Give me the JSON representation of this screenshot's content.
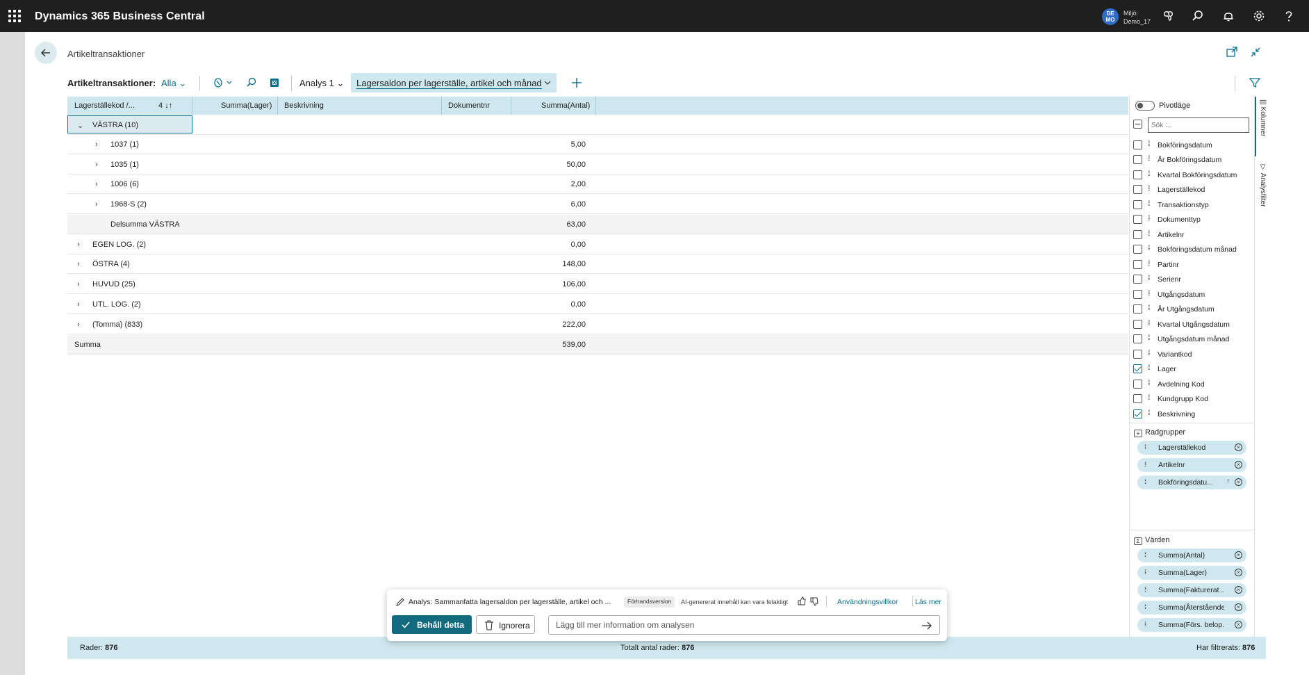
{
  "app": {
    "name": "Dynamics 365 Business Central",
    "avatar_initials_top": "DE",
    "avatar_initials_bottom": "MO",
    "env_label": "Miljö:",
    "env_name": "Demo_17"
  },
  "page": {
    "title": "Artikeltransaktioner"
  },
  "actionbar": {
    "title": "Artikeltransaktioner:",
    "filter": "Alla",
    "analysis": "Analys 1",
    "active_tab": "Lagersaldon per lagerställe, artikel och månad"
  },
  "grid": {
    "columns": {
      "group": "Lagerställekod /...",
      "sort": "4",
      "summa_lager": "Summa(Lager)",
      "beskrivning": "Beskrivning",
      "dokumentnr": "Dokumentnr",
      "summa_antal": "Summa(Antal)"
    },
    "rows": [
      {
        "label": "VÄSTRA (10)",
        "value": ""
      },
      {
        "label": "1037 (1)",
        "value": "5,00"
      },
      {
        "label": "1035 (1)",
        "value": "50,00"
      },
      {
        "label": "1006 (6)",
        "value": "2,00"
      },
      {
        "label": "1968-S (2)",
        "value": "6,00"
      },
      {
        "label": "Delsumma VÄSTRA",
        "value": "63,00"
      },
      {
        "label": "EGEN LOG. (2)",
        "value": "0,00"
      },
      {
        "label": "ÖSTRA (4)",
        "value": "148,00"
      },
      {
        "label": "HUVUD (25)",
        "value": "106,00"
      },
      {
        "label": "UTL. LOG. (2)",
        "value": "0,00"
      },
      {
        "label": "(Tomma) (833)",
        "value": "222,00"
      },
      {
        "label": "Summa",
        "value": "539,00"
      }
    ]
  },
  "pivot_panel": {
    "pivot_label": "Pivotläge",
    "search_placeholder": "Sök ...",
    "fields": [
      {
        "name": "Bokföringsdatum",
        "checked": false
      },
      {
        "name": "År Bokföringsdatum",
        "checked": false
      },
      {
        "name": "Kvartal Bokföringsdatum",
        "checked": false
      },
      {
        "name": "Lagerställekod",
        "checked": false
      },
      {
        "name": "Transaktionstyp",
        "checked": false
      },
      {
        "name": "Dokumenttyp",
        "checked": false
      },
      {
        "name": "Artikelnr",
        "checked": false
      },
      {
        "name": "Bokföringsdatum månad",
        "checked": false
      },
      {
        "name": "Partinr",
        "checked": false
      },
      {
        "name": "Serienr",
        "checked": false
      },
      {
        "name": "Utgångsdatum",
        "checked": false
      },
      {
        "name": "År Utgångsdatum",
        "checked": false
      },
      {
        "name": "Kvartal Utgångsdatum",
        "checked": false
      },
      {
        "name": "Utgångsdatum månad",
        "checked": false
      },
      {
        "name": "Variantkod",
        "checked": false
      },
      {
        "name": "Lager",
        "checked": true
      },
      {
        "name": "Avdelning Kod",
        "checked": false
      },
      {
        "name": "Kundgrupp Kod",
        "checked": false
      },
      {
        "name": "Beskrivning",
        "checked": true
      }
    ],
    "rowgroups_title": "Radgrupper",
    "rowgroups": [
      "Lagerställekod",
      "Artikelnr",
      "Bokföringsdatu..."
    ],
    "values_title": "Värden",
    "values": [
      "Summa(Antal)",
      "Summa(Lager)",
      "Summa(Fakturerat ...",
      "Summa(Återstående...",
      "Summa(Förs. belop..."
    ],
    "vtab_columns": "Kolumner",
    "vtab_filter": "Analysfilter"
  },
  "copilot": {
    "text": "Analys: Sammanfatta lagersaldon per lagerställe, artikel och ...",
    "badge": "Förhandsversion",
    "warning": "AI-genererat innehåll kan vara felaktigt",
    "terms_link": "Användningsvillkor",
    "more_link": "Läs mer",
    "keep_label": "Behåll detta",
    "ignore_label": "Ignorera",
    "input_placeholder": "Lägg till mer information om analysen"
  },
  "status": {
    "rows_label": "Rader:",
    "rows_value": "876",
    "total_label": "Totalt antal rader:",
    "total_value": "876",
    "filtered_label": "Har filtrerats:",
    "filtered_value": "876"
  },
  "colors": {
    "accent": "#0a6f8a",
    "header_bg": "#cfe7ee",
    "topbar": "#1f1f1f",
    "keep_button": "#126b7c"
  }
}
